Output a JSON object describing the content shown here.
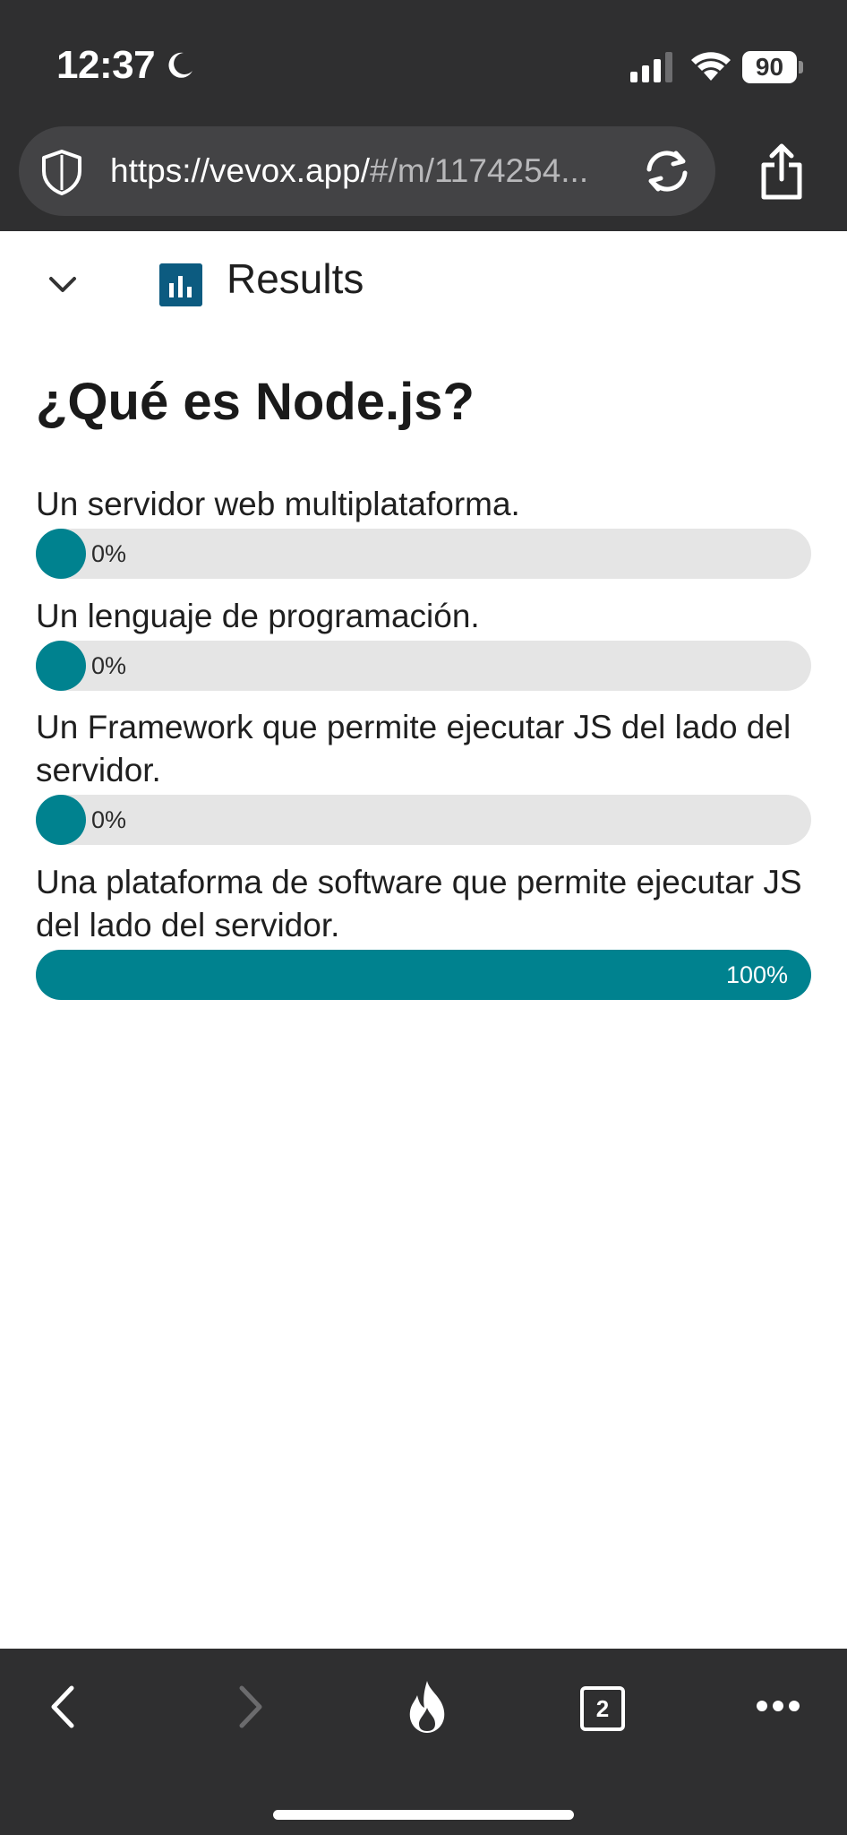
{
  "status_bar": {
    "time": "12:37",
    "battery": "90"
  },
  "browser": {
    "url_main": "https://vevox.app/",
    "url_rest": "#/m/1174254..."
  },
  "results": {
    "title": "Results"
  },
  "question": "¿Qué es Node.js?",
  "options": [
    {
      "label": "Un servidor web multiplataforma.",
      "percent_text": "0%",
      "percent": 0
    },
    {
      "label": "Un lenguaje de programación.",
      "percent_text": "0%",
      "percent": 0
    },
    {
      "label": "Un Framework que permite ejecutar JS del lado del servidor.",
      "percent_text": "0%",
      "percent": 0
    },
    {
      "label": "Una plataforma de software que permite ejecutar JS del lado del servidor.",
      "percent_text": "100%",
      "percent": 100
    }
  ],
  "toolbar": {
    "tabs_count": "2"
  },
  "colors": {
    "chrome": "#2f2f30",
    "bar_fill": "#00828f",
    "bar_track": "#e5e5e5",
    "results_icon": "#0c5b80"
  }
}
